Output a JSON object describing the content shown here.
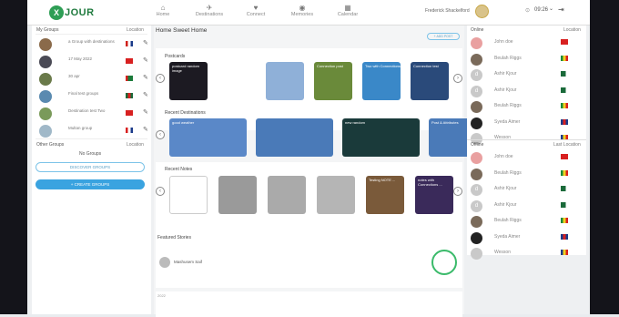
{
  "brand": {
    "logo_mark": "X",
    "logo_text": "JOUR"
  },
  "nav": {
    "items": [
      {
        "label": "Home",
        "icon": "home-icon",
        "glyph": "⌂"
      },
      {
        "label": "Destinations",
        "icon": "plane-icon",
        "glyph": "✈"
      },
      {
        "label": "Connect",
        "icon": "heart-icon",
        "glyph": "♥"
      },
      {
        "label": "Memories",
        "icon": "camera-icon",
        "glyph": "◉"
      },
      {
        "label": "Calendar",
        "icon": "calendar-icon",
        "glyph": "▦"
      }
    ],
    "user_name": "Frederick Shackelford",
    "time": "09:26",
    "time_caret": "⌄",
    "logout_glyph": "⇥"
  },
  "left": {
    "my_groups": "My Groups",
    "location": "Location",
    "groups": [
      {
        "name": "a Group with destinations",
        "thumb": "#8a6a4a",
        "flag": [
          "#d0201a",
          "#fff",
          "#1a3a8a"
        ]
      },
      {
        "name": "17 May 2022",
        "thumb": "#4a4a55",
        "flag": [
          "#d82020",
          "#d82020",
          "#d82020"
        ]
      },
      {
        "name": "30 apr",
        "thumb": "#6a7a4a",
        "flag": [
          "#d82020",
          "#1a7a3a",
          "#1a7a3a"
        ]
      },
      {
        "name": "Final test groups",
        "thumb": "#5a8ab0",
        "flag": [
          "#1a6a3a",
          "#d82020",
          "#1a6a3a"
        ]
      },
      {
        "name": "Destination test Two",
        "thumb": "#7a9a5a",
        "flag": [
          "#d82020",
          "#d82020",
          "#d82020"
        ]
      },
      {
        "name": "Multan group",
        "thumb": "#a0b8c8",
        "flag": [
          "#d82020",
          "#fff",
          "#1a3a8a"
        ]
      }
    ],
    "other_groups": "Other Groups",
    "other_location": "Location",
    "no_groups": "No Groups",
    "discover": "DISCOVER GROUPS",
    "create": "+ CREATE GROUPS"
  },
  "main": {
    "title": "Home Sweet Home",
    "add_post": "+ ADD POST",
    "postcards_label": "Postcards",
    "postcards": [
      {
        "caption": "postcard random image",
        "bg": "#1c1a22"
      },
      {
        "caption": "",
        "bg": "#ffffff"
      },
      {
        "caption": "",
        "bg": "#8fb0d8"
      },
      {
        "caption": "Connection post",
        "bg": "#6a8a3a"
      },
      {
        "caption": "Two with Connections",
        "bg": "#3a88c8"
      },
      {
        "caption": "Connection test",
        "bg": "#2a4a7a"
      }
    ],
    "destinations_label": "Recent Destinations",
    "destinations": [
      {
        "caption": "good weather",
        "bg": "#5a88c8"
      },
      {
        "caption": "",
        "bg": "#4a7ab8"
      },
      {
        "caption": "new random",
        "bg": "#1a3a3a"
      },
      {
        "caption": "Post & Attributes",
        "bg": "#4a7ab8"
      }
    ],
    "notes_label": "Recent Notes",
    "notes": [
      {
        "caption": "",
        "bg": "#ffffff"
      },
      {
        "caption": "",
        "bg": "#9a9a9a"
      },
      {
        "caption": "",
        "bg": "#aaaaaa"
      },
      {
        "caption": "",
        "bg": "#b5b5b5"
      },
      {
        "caption": "Testing NOTE ...",
        "bg": "#7a5a3a"
      },
      {
        "caption": "notes with Connections ...",
        "bg": "#3a2a5a"
      }
    ],
    "stories_label": "Featured Stories",
    "story_author": "Mashusem Saif",
    "next_label": "2022"
  },
  "right": {
    "online": "Online",
    "location": "Location",
    "online_users": [
      {
        "name": "John doe",
        "av": "#e9a0a0",
        "letter": "",
        "flag": [
          "#d82020",
          "#d82020",
          "#d82020"
        ]
      },
      {
        "name": "Beulah Riggs",
        "av": "#7a6a5a",
        "letter": "",
        "flag": [
          "#1a8a3a",
          "#f0d020",
          "#d82020"
        ]
      },
      {
        "name": "Ashir Kjour",
        "av": "#c9c9c9",
        "letter": "d",
        "flag": [
          "#1a6a3a",
          "#1a6a3a",
          "#ffffff"
        ]
      },
      {
        "name": "Ashir Kjour",
        "av": "#c9c9c9",
        "letter": "d",
        "flag": [
          "#1a6a3a",
          "#1a6a3a",
          "#ffffff"
        ]
      },
      {
        "name": "Beulah Riggs",
        "av": "#7a6a5a",
        "letter": "",
        "flag": [
          "#1a8a3a",
          "#f0d020",
          "#d82020"
        ]
      },
      {
        "name": "Syeda Aimer",
        "av": "#222222",
        "letter": "",
        "flag": [
          "#1a3a8a",
          "#d82020",
          "#1a3a8a"
        ]
      },
      {
        "name": "Wesson",
        "av": "#c9c9c9",
        "letter": "",
        "flag": [
          "#1a3a8a",
          "#f0d020",
          "#d82020"
        ]
      }
    ],
    "offline": "Offline",
    "last_location": "Last Location",
    "offline_users": [
      {
        "name": "John doe",
        "av": "#e9a0a0",
        "letter": "",
        "flag": [
          "#d82020",
          "#d82020",
          "#d82020"
        ]
      },
      {
        "name": "Beulah Riggs",
        "av": "#7a6a5a",
        "letter": "",
        "flag": [
          "#1a8a3a",
          "#f0d020",
          "#d82020"
        ]
      },
      {
        "name": "Ashir Kjour",
        "av": "#c9c9c9",
        "letter": "d",
        "flag": [
          "#1a6a3a",
          "#1a6a3a",
          "#ffffff"
        ]
      },
      {
        "name": "Ashir Kjour",
        "av": "#c9c9c9",
        "letter": "d",
        "flag": [
          "#1a6a3a",
          "#1a6a3a",
          "#ffffff"
        ]
      },
      {
        "name": "Beulah Riggs",
        "av": "#7a6a5a",
        "letter": "",
        "flag": [
          "#1a8a3a",
          "#f0d020",
          "#d82020"
        ]
      },
      {
        "name": "Syeda Aimer",
        "av": "#222222",
        "letter": "",
        "flag": [
          "#1a3a8a",
          "#d82020",
          "#1a3a8a"
        ]
      },
      {
        "name": "Wesson",
        "av": "#c9c9c9",
        "letter": "",
        "flag": [
          "#1a3a8a",
          "#f0d020",
          "#d82020"
        ]
      }
    ]
  }
}
